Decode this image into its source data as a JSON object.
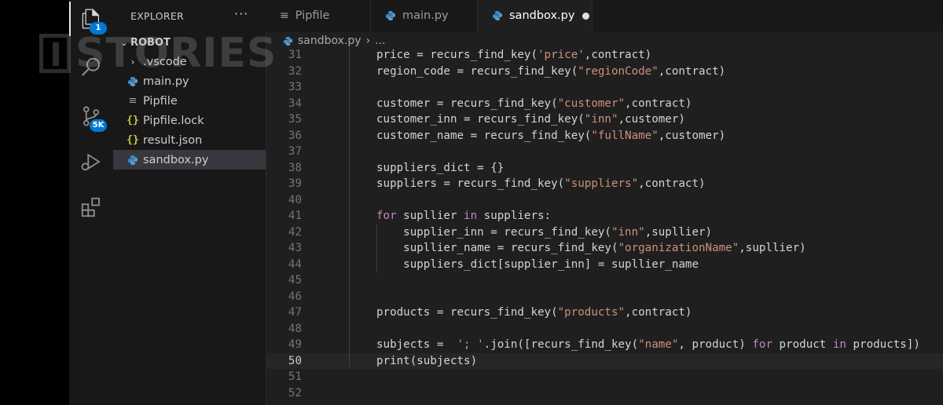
{
  "activity_bar": {
    "explorer_badge": "1",
    "scm_badge": "5K"
  },
  "sidebar": {
    "title": "EXPLORER",
    "more_actions": "···",
    "folder_name": "ROBOT",
    "items": [
      {
        "label": ".vscode",
        "icon": "chevron-right-icon"
      },
      {
        "label": "main.py",
        "icon": "python-icon"
      },
      {
        "label": "Pipfile",
        "icon": "lines-icon"
      },
      {
        "label": "Pipfile.lock",
        "icon": "json-braces-icon"
      },
      {
        "label": "result.json",
        "icon": "json-braces-icon"
      },
      {
        "label": "sandbox.py",
        "icon": "python-icon"
      }
    ]
  },
  "watermark": "STORIES",
  "tabs": [
    {
      "label": "Pipfile",
      "icon": "lines-icon"
    },
    {
      "label": "main.py",
      "icon": "python-icon"
    },
    {
      "label": "sandbox.py",
      "icon": "python-icon",
      "modified": true
    }
  ],
  "breadcrumb": {
    "file": "sandbox.py",
    "sep": "›",
    "rest": "..."
  },
  "colors": {
    "python_icon": "#3d8ec9",
    "string": "#ce9178",
    "keyword": "#c586c0",
    "background": "#1f1f1f"
  },
  "editor": {
    "current_line": "50",
    "lines": [
      {
        "n": "31",
        "text": "price = recurs_find_key('price',contract)"
      },
      {
        "n": "32",
        "text": "region_code = recurs_find_key(\"regionCode\",contract)"
      },
      {
        "n": "33",
        "text": ""
      },
      {
        "n": "34",
        "text": "customer = recurs_find_key(\"customer\",contract)"
      },
      {
        "n": "35",
        "text": "customer_inn = recurs_find_key(\"inn\",customer)"
      },
      {
        "n": "36",
        "text": "customer_name = recurs_find_key(\"fullName\",customer)"
      },
      {
        "n": "37",
        "text": ""
      },
      {
        "n": "38",
        "text": "suppliers_dict = {}"
      },
      {
        "n": "39",
        "text": "suppliers = recurs_find_key(\"suppliers\",contract)"
      },
      {
        "n": "40",
        "text": ""
      },
      {
        "n": "41",
        "text": "for supllier in suppliers:"
      },
      {
        "n": "42",
        "text": "    supplier_inn = recurs_find_key(\"inn\",supllier)"
      },
      {
        "n": "43",
        "text": "    supllier_name = recurs_find_key(\"organizationName\",supllier)"
      },
      {
        "n": "44",
        "text": "    suppliers_dict[supplier_inn] = supllier_name"
      },
      {
        "n": "45",
        "text": ""
      },
      {
        "n": "46",
        "text": ""
      },
      {
        "n": "47",
        "text": "products = recurs_find_key(\"products\",contract)"
      },
      {
        "n": "48",
        "text": ""
      },
      {
        "n": "49",
        "text": "subjects =  '; '.join([recurs_find_key(\"name\", product) for product in products])"
      },
      {
        "n": "50",
        "text": "print(subjects)"
      },
      {
        "n": "51",
        "text": ""
      },
      {
        "n": "52",
        "text": ""
      }
    ]
  }
}
